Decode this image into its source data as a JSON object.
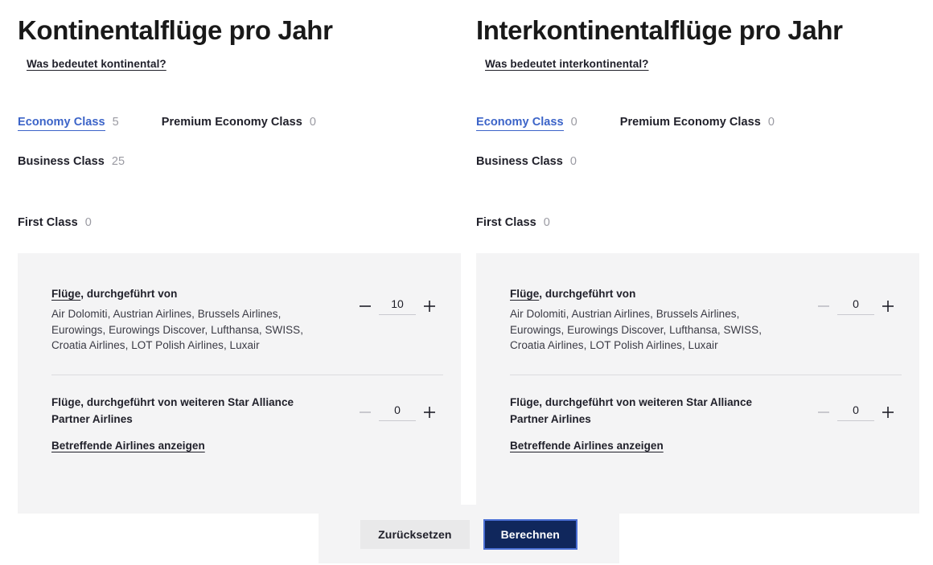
{
  "colors": {
    "accent_blue": "#3c64c8",
    "primary_navy": "#10275c",
    "card_bg": "#f4f4f5",
    "text_dark": "#20202a",
    "muted": "#9a9aa2",
    "divider": "#dcdcdf"
  },
  "columns": [
    {
      "key": "kontinental",
      "title": "Kontinentalflüge pro Jahr",
      "info_link": "Was bedeutet kontinental?",
      "tabs": [
        {
          "label": "Economy Class",
          "count": "5",
          "active": false
        },
        {
          "label": "Premium Economy Class",
          "count": "0",
          "active": false
        },
        {
          "label": "Business Class",
          "count": "25",
          "active": true
        },
        {
          "label": "First Class",
          "count": "0",
          "active": false
        }
      ],
      "sections": [
        {
          "heading_link": "Flüge",
          "heading_rest": ", durchgeführt von",
          "body": "Air Dolomiti, Austrian Airlines, Brussels Airlines, Eurowings, Eurowings Discover, Lufthansa, SWISS, Croatia Airlines, LOT Polish Airlines, Luxair",
          "sublink": "",
          "value": "10",
          "minus_label": "−",
          "plus_label": "+",
          "minus_disabled": false
        },
        {
          "heading_link": "",
          "heading_rest": "Flüge, durchgeführt von weiteren Star Alliance Partner Airlines",
          "body": "",
          "sublink": "Betreffende Airlines anzeigen",
          "value": "0",
          "minus_label": "−",
          "plus_label": "+",
          "minus_disabled": true
        }
      ]
    },
    {
      "key": "interkontinental",
      "title": "Interkontinentalflüge pro Jahr",
      "info_link": "Was bedeutet interkontinental?",
      "tabs": [
        {
          "label": "Economy Class",
          "count": "0",
          "active": true
        },
        {
          "label": "Premium Economy Class",
          "count": "0",
          "active": false
        },
        {
          "label": "Business Class",
          "count": "0",
          "active": false
        },
        {
          "label": "First Class",
          "count": "0",
          "active": false
        }
      ],
      "sections": [
        {
          "heading_link": "Flüge",
          "heading_rest": ", durchgeführt von",
          "body": "Air Dolomiti, Austrian Airlines, Brussels Airlines, Eurowings, Eurowings Discover, Lufthansa, SWISS, Croatia Airlines, LOT Polish Airlines, Luxair",
          "sublink": "",
          "value": "0",
          "minus_label": "−",
          "plus_label": "+",
          "minus_disabled": true
        },
        {
          "heading_link": "",
          "heading_rest": "Flüge, durchgeführt von weiteren Star Alliance Partner Airlines",
          "body": "",
          "sublink": "Betreffende Airlines anzeigen",
          "value": "0",
          "minus_label": "−",
          "plus_label": "+",
          "minus_disabled": true
        }
      ]
    }
  ],
  "actions": {
    "reset_label": "Zurücksetzen",
    "calculate_label": "Berechnen"
  }
}
